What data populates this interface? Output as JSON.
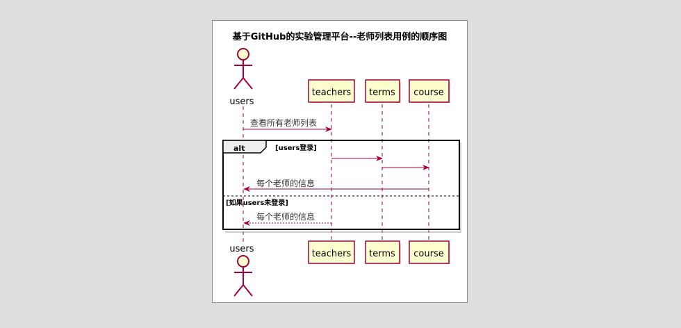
{
  "diagram": {
    "title": "基于GitHub的实验管理平台--老师列表用例的顺序图",
    "actor": {
      "name": "users"
    },
    "participants": [
      {
        "id": "teachers",
        "label": "teachers"
      },
      {
        "id": "terms",
        "label": "terms"
      },
      {
        "id": "course",
        "label": "course"
      }
    ],
    "messages": [
      {
        "from": "users",
        "to": "teachers",
        "label": "查看所有老师列表",
        "style": "solid"
      },
      {
        "from": "teachers",
        "to": "terms",
        "label": "",
        "style": "solid"
      },
      {
        "from": "terms",
        "to": "course",
        "label": "",
        "style": "solid"
      },
      {
        "from": "course",
        "to": "users",
        "label": "每个老师的信息",
        "style": "solid"
      },
      {
        "from": "teachers",
        "to": "users",
        "label": "每个老师的信息",
        "style": "dashed"
      }
    ],
    "alt_fragment": {
      "operator": "alt",
      "guard_1": "[users登录]",
      "guard_2": "[如果users未登录]"
    },
    "colors": {
      "lifeline_border": "#a80036",
      "participant_fill": "#fefece",
      "arrow": "#a80036",
      "background": "#dedede",
      "panel": "#ffffff"
    }
  }
}
